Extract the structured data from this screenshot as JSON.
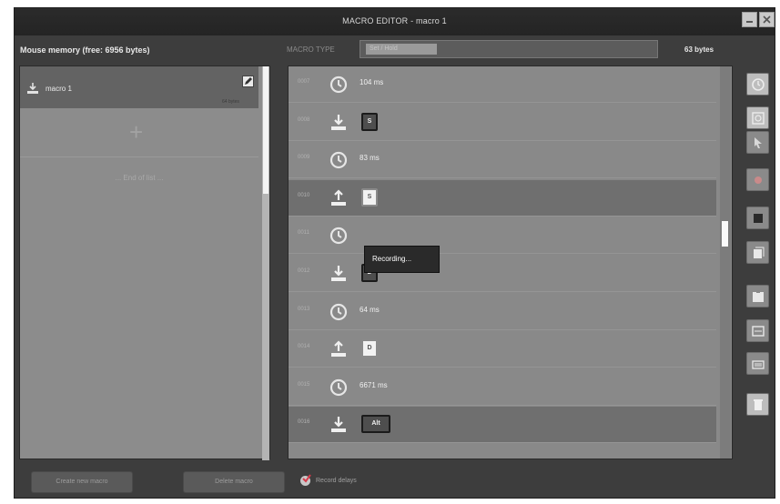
{
  "window": {
    "title": "MACRO EDITOR - macro 1"
  },
  "header": {
    "memory_label": "Mouse memory (free: 6956 bytes)",
    "macro_type_label": "MACRO TYPE",
    "macro_type_value": "Set / Hold",
    "bytes": "63 bytes"
  },
  "macro_list": {
    "items": [
      {
        "name": "macro 1",
        "subtitle": "64 bytes"
      }
    ],
    "end_of_list": "... End of list ..."
  },
  "events": [
    {
      "num": "0007",
      "type": "delay",
      "text": "104 ms"
    },
    {
      "num": "0008",
      "type": "key-down",
      "key": "S"
    },
    {
      "num": "0009",
      "type": "delay",
      "text": "83 ms"
    },
    {
      "num": "0010",
      "type": "key-up",
      "key": "S",
      "selected": true
    },
    {
      "num": "0011",
      "type": "delay",
      "text": ""
    },
    {
      "num": "0012",
      "type": "key-down",
      "key": "D"
    },
    {
      "num": "0013",
      "type": "delay",
      "text": "64 ms"
    },
    {
      "num": "0014",
      "type": "key-up",
      "key": "D"
    },
    {
      "num": "0015",
      "type": "delay",
      "text": "6671 ms"
    },
    {
      "num": "0016",
      "type": "key-down",
      "key": "Alt",
      "selected": true
    }
  ],
  "tooltip": {
    "text": "Recording..."
  },
  "tools": [
    {
      "icon": "clock-icon",
      "color": "#bdbdbd"
    },
    {
      "icon": "insert-clock-icon",
      "color": "#bdbdbd"
    },
    {
      "icon": "cursor-icon",
      "color": "#8a8a8a"
    },
    {
      "icon": "record-icon",
      "color": "#8a8a8a"
    },
    {
      "icon": "stop-icon",
      "color": "#8a8a8a"
    },
    {
      "icon": "copy-icon",
      "color": "#8a8a8a"
    },
    {
      "icon": "paste-icon",
      "color": "#8a8a8a"
    },
    {
      "icon": "edit-icon",
      "color": "#8a8a8a"
    },
    {
      "icon": "keyboard-icon",
      "color": "#8a8a8a"
    },
    {
      "icon": "trash-icon",
      "color": "#bdbdbd"
    }
  ],
  "bottom": {
    "create_button": "Create new macro",
    "delete_button": "Delete macro",
    "record_delay_label": "Record delays",
    "record_delay_checked": true
  },
  "colors": {
    "accent": "#d63b4b",
    "window_bg": "#3d3d3d",
    "list_bg": "#898989"
  }
}
